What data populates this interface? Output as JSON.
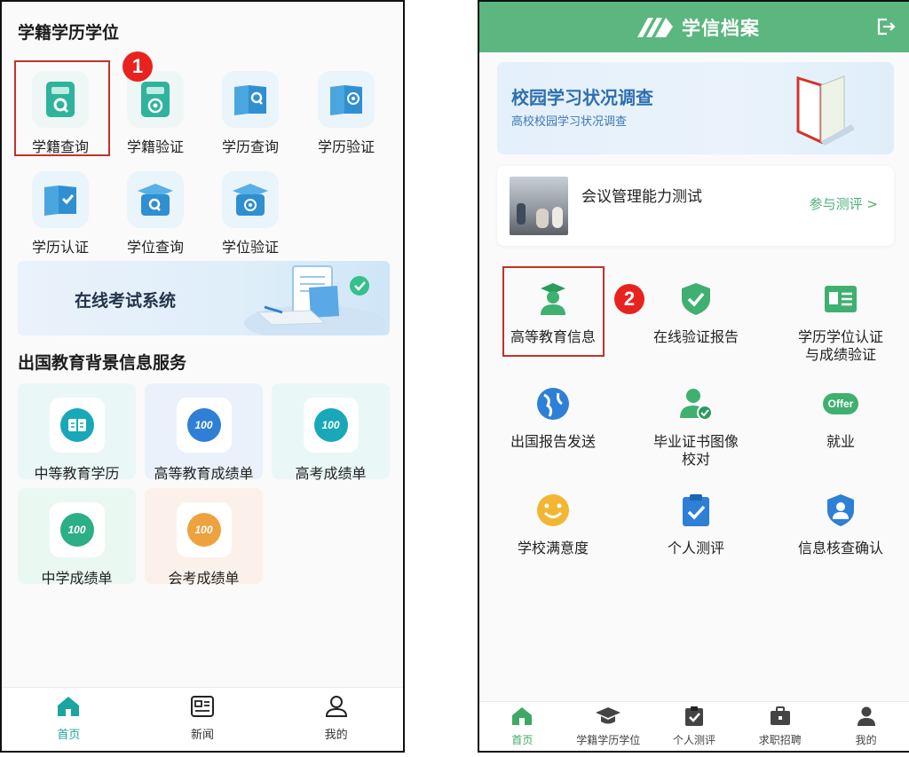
{
  "left": {
    "section1_title": "学籍学历学位",
    "grid": [
      {
        "label": "学籍查询",
        "icon": "student-record-search-icon"
      },
      {
        "label": "学籍验证",
        "icon": "student-record-verify-icon"
      },
      {
        "label": "学历查询",
        "icon": "diploma-search-icon"
      },
      {
        "label": "学历验证",
        "icon": "diploma-verify-icon"
      },
      {
        "label": "学历认证",
        "icon": "diploma-certify-icon"
      },
      {
        "label": "学位查询",
        "icon": "degree-search-icon"
      },
      {
        "label": "学位验证",
        "icon": "degree-verify-icon"
      }
    ],
    "step_badge": "1",
    "banner_text": "在线考试系统",
    "section2_title": "出国教育背景信息服务",
    "cards": [
      {
        "label": "中等教育学历",
        "icon": "secondary-education-icon"
      },
      {
        "label": "高等教育成绩单",
        "icon": "higher-education-transcript-icon"
      },
      {
        "label": "高考成绩单",
        "icon": "gaokao-transcript-icon"
      },
      {
        "label": "中学成绩单",
        "icon": "middle-school-transcript-icon"
      },
      {
        "label": "会考成绩单",
        "icon": "graduation-exam-transcript-icon"
      }
    ],
    "tabs": [
      {
        "label": "首页",
        "icon": "home-icon"
      },
      {
        "label": "新闻",
        "icon": "news-icon"
      },
      {
        "label": "我的",
        "icon": "profile-icon"
      }
    ]
  },
  "right": {
    "header_title": "学信档案",
    "banner": {
      "title": "校园学习状况调查",
      "subtitle": "高校校园学习状况调查"
    },
    "test_card": {
      "title": "会议管理能力测试",
      "link": "参与测评 >"
    },
    "step_badge": "2",
    "services": [
      {
        "label": "高等教育信息",
        "icon": "graduate-cap-person-icon"
      },
      {
        "label": "在线验证报告",
        "icon": "shield-check-icon"
      },
      {
        "label": "学历学位认证\n与成绩验证",
        "icon": "id-card-icon"
      },
      {
        "label": "出国报告发送",
        "icon": "globe-icon"
      },
      {
        "label": "毕业证书图像\n校对",
        "icon": "person-check-icon"
      },
      {
        "label": "就业",
        "icon": "offer-icon"
      },
      {
        "label": "学校满意度",
        "icon": "smiley-icon"
      },
      {
        "label": "个人测评",
        "icon": "clipboard-check-icon"
      },
      {
        "label": "信息核查确认",
        "icon": "shield-person-icon"
      }
    ],
    "offer_text": "Offer",
    "tabs": [
      {
        "label": "首页",
        "icon": "home-icon"
      },
      {
        "label": "学籍学历学位",
        "icon": "graduation-cap-icon"
      },
      {
        "label": "个人测评",
        "icon": "clipboard-check-icon"
      },
      {
        "label": "求职招聘",
        "icon": "briefcase-icon"
      },
      {
        "label": "我的",
        "icon": "person-icon"
      }
    ]
  },
  "colors": {
    "teal": "#1aa6a0",
    "green": "#5cb67f",
    "blue": "#2e7fd6",
    "highlight_red": "#c0332b",
    "badge_red": "#e8231f"
  }
}
